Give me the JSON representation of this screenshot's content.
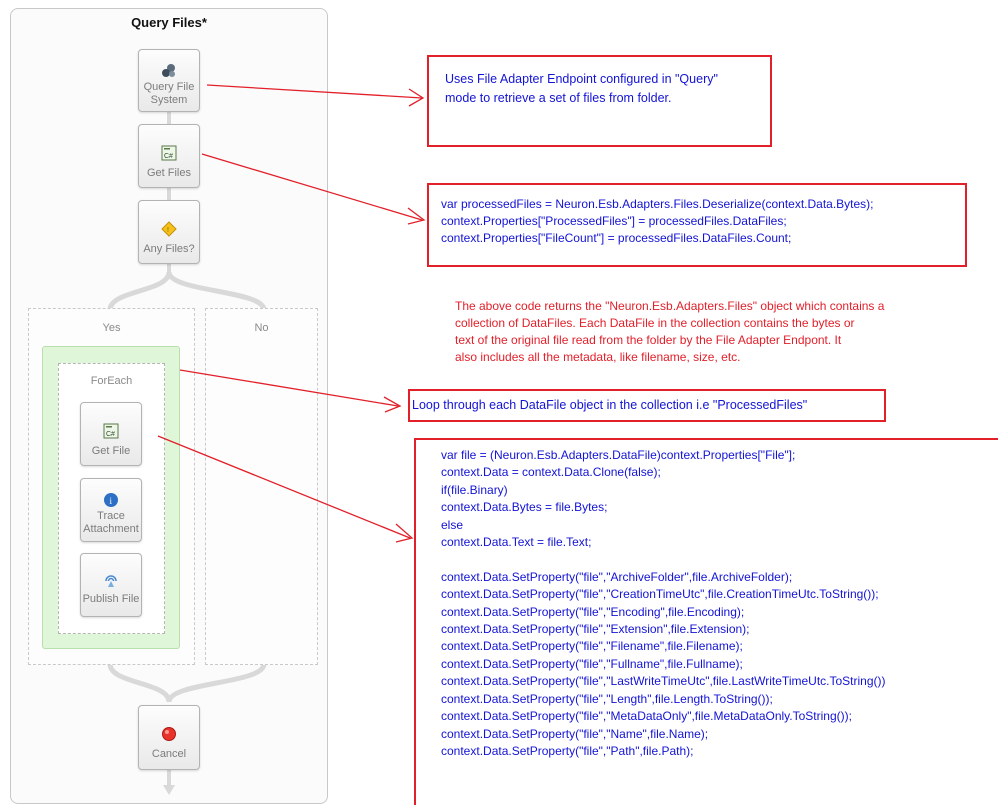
{
  "designer": {
    "title": "Query Files*",
    "steps": {
      "query": "Query File\nSystem",
      "get_files": "Get Files",
      "any_files": "Any Files?",
      "get_file": "Get File",
      "trace": "Trace\nAttachment",
      "publish": "Publish File",
      "cancel": "Cancel"
    },
    "branches": {
      "yes": "Yes",
      "no": "No",
      "foreach": "ForEach"
    }
  },
  "annotations": {
    "query_note": "Uses File Adapter Endpoint configured in \"Query\"\nmode to retrieve a set of files from folder.",
    "get_files_code": "var processedFiles = Neuron.Esb.Adapters.Files.Deserialize(context.Data.Bytes);\ncontext.Properties[\"ProcessedFiles\"] = processedFiles.DataFiles;\ncontext.Properties[\"FileCount\"] = processedFiles.DataFiles.Count;",
    "explanation": "The above code returns the \"Neuron.Esb.Adapters.Files\" object which contains a\ncollection of DataFiles. Each DataFile in the collection contains the bytes or\ntext of the original file read from the folder by the File Adapter Endpont. It\nalso includes all the metadata, like filename, size, etc.",
    "loop_note": "Loop through each DataFile object in the collection i.e \"ProcessedFiles\"",
    "get_file_code": "var file = (Neuron.Esb.Adapters.DataFile)context.Properties[\"File\"];\ncontext.Data = context.Data.Clone(false);\nif(file.Binary)\ncontext.Data.Bytes = file.Bytes;\nelse\ncontext.Data.Text = file.Text;\n\ncontext.Data.SetProperty(\"file\",\"ArchiveFolder\",file.ArchiveFolder);\ncontext.Data.SetProperty(\"file\",\"CreationTimeUtc\",file.CreationTimeUtc.ToString());\ncontext.Data.SetProperty(\"file\",\"Encoding\",file.Encoding);\ncontext.Data.SetProperty(\"file\",\"Extension\",file.Extension);\ncontext.Data.SetProperty(\"file\",\"Filename\",file.Filename);\ncontext.Data.SetProperty(\"file\",\"Fullname\",file.Fullname);\ncontext.Data.SetProperty(\"file\",\"LastWriteTimeUtc\",file.LastWriteTimeUtc.ToString())\ncontext.Data.SetProperty(\"file\",\"Length\",file.Length.ToString());\ncontext.Data.SetProperty(\"file\",\"MetaDataOnly\",file.MetaDataOnly.ToString());\ncontext.Data.SetProperty(\"file\",\"Name\",file.Name);\ncontext.Data.SetProperty(\"file\",\"Path\",file.Path);"
  },
  "colors": {
    "annotation_red": "#e2202a",
    "annotation_blue": "#1313d6",
    "foreach_green": "#dff7d8"
  }
}
